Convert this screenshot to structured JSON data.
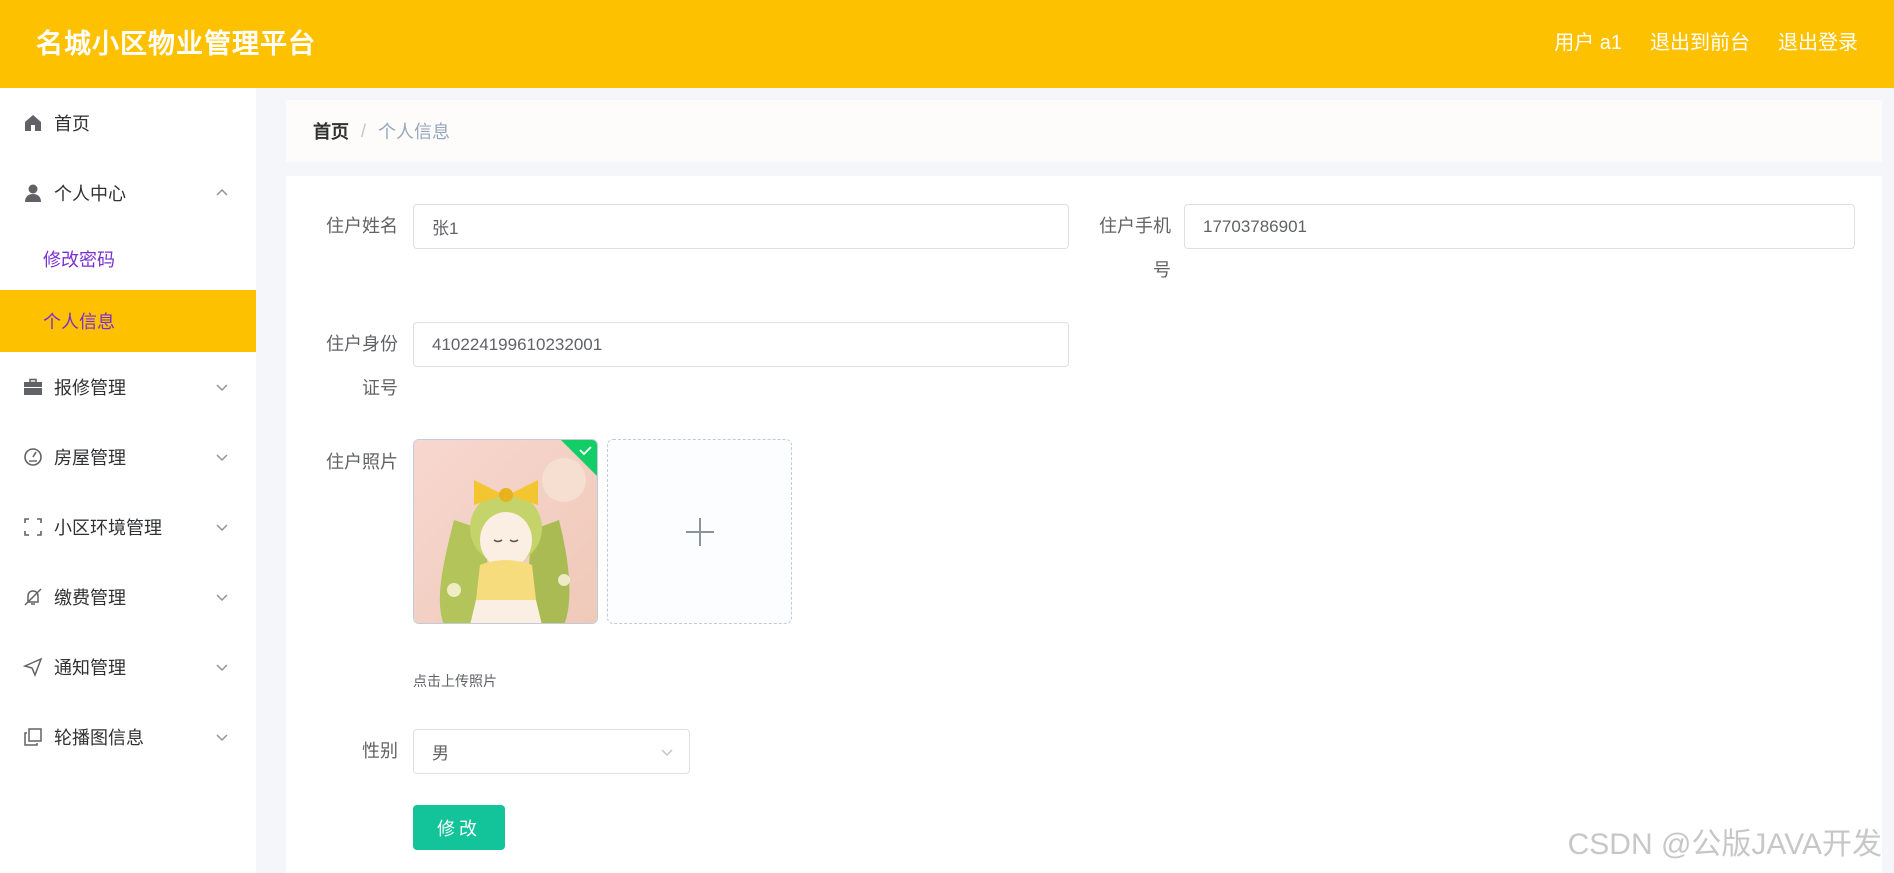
{
  "header": {
    "title": "名城小区物业管理平台",
    "user": "用户 a1",
    "to_front": "退出到前台",
    "logout": "退出登录"
  },
  "sidebar": {
    "items": [
      {
        "label": "首页",
        "icon": "home-icon"
      },
      {
        "label": "个人中心",
        "icon": "user-icon",
        "expanded": true,
        "children": [
          {
            "label": "修改密码"
          },
          {
            "label": "个人信息",
            "active": true
          }
        ]
      },
      {
        "label": "报修管理",
        "icon": "briefcase-icon"
      },
      {
        "label": "房屋管理",
        "icon": "gauge-icon"
      },
      {
        "label": "小区环境管理",
        "icon": "frame-icon"
      },
      {
        "label": "缴费管理",
        "icon": "bell-off-icon"
      },
      {
        "label": "通知管理",
        "icon": "send-icon"
      },
      {
        "label": "轮播图信息",
        "icon": "copy-icon"
      }
    ]
  },
  "breadcrumb": {
    "home": "首页",
    "separator": "/",
    "current": "个人信息"
  },
  "form": {
    "name_label": "住户姓名",
    "name_value": "张1",
    "phone_label_1": "住户手机",
    "phone_label_2": "号",
    "phone_value": "17703786901",
    "idcard_label_1": "住户身份",
    "idcard_label_2": "证号",
    "idcard_value": "410224199610232001",
    "photo_label": "住户照片",
    "photo_tip": "点击上传照片",
    "gender_label": "性别",
    "gender_value": "男",
    "submit": "修改"
  },
  "watermark": "CSDN @公版JAVA开发",
  "colors": {
    "header_bg": "#fec100",
    "active_menu_bg": "#fec100",
    "submenu_text": "#7b2fd0",
    "button_bg": "#13c39a",
    "upload_success": "#13ce66"
  }
}
